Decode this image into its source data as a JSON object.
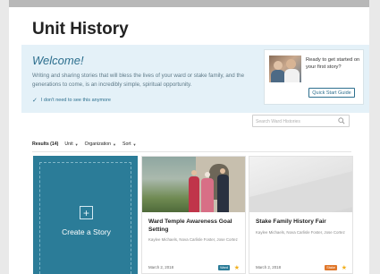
{
  "page": {
    "title": "Unit History"
  },
  "welcome": {
    "heading": "Welcome!",
    "text": "Writing and sharing stories that will bless the lives of your ward or stake family, and the generations to come, is an incredibly simple, spiritual opportunity.",
    "dismiss_label": "I don't need to see this anymore"
  },
  "quick_start": {
    "text": "Ready to get started on your first story?",
    "button_label": "Quick Start Guide"
  },
  "search": {
    "placeholder": "Search Ward Histories"
  },
  "filters": {
    "results_label": "Results (14)",
    "unit_label": "Unit",
    "organization_label": "Organization",
    "sort_label": "Sort"
  },
  "create_card": {
    "label": "Create a Story"
  },
  "stories": [
    {
      "title": "Ward Temple Awareness Goal Setting",
      "authors": "Kaylee Michaels, Nova Carlisle Foster, Jose Cortez",
      "date": "March 2, 2018",
      "badge": "Ward",
      "badge_color": "#2b7c98"
    },
    {
      "title": "Stake Family History Fair",
      "authors": "Kaylee Michaels, Nova Carlisle Foster, Jose Cortez",
      "date": "March 2, 2018",
      "badge": "Stake",
      "badge_color": "#e0772a"
    }
  ],
  "colors": {
    "accent": "#2b7c98",
    "welcome_bg": "#e4f1f8",
    "star": "#f2b01e"
  }
}
